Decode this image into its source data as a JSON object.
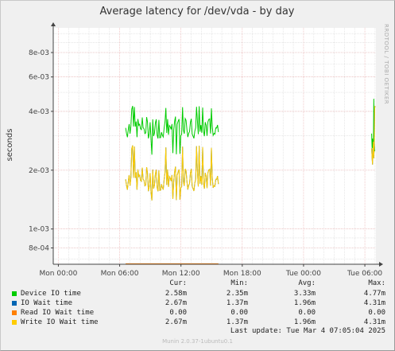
{
  "page": {
    "title": "Average latency for /dev/vda - by day",
    "side_label": "RRDTOOL / TOBI OETIKER",
    "footer": "Munin 2.0.37-1ubuntu0.1",
    "last_update": "Last update: Tue Mar  4 07:05:04 2025"
  },
  "legend": {
    "headers": [
      "Cur:",
      "Min:",
      "Avg:",
      "Max:"
    ],
    "rows": [
      {
        "label": "Device IO time",
        "color": "#00cc00",
        "cur": "2.58m",
        "min": "2.35m",
        "avg": "3.33m",
        "max": "4.77m"
      },
      {
        "label": "IO Wait time",
        "color": "#0066b3",
        "cur": "2.67m",
        "min": "1.37m",
        "avg": "1.96m",
        "max": "4.31m"
      },
      {
        "label": "Read IO Wait time",
        "color": "#ff8000",
        "cur": "0.00",
        "min": "0.00",
        "avg": "0.00",
        "max": "0.00"
      },
      {
        "label": "Write IO Wait time",
        "color": "#ffcc00",
        "cur": "2.67m",
        "min": "1.37m",
        "avg": "1.96m",
        "max": "4.31m"
      }
    ]
  },
  "chart_data": {
    "type": "line",
    "title": "Average latency for /dev/vda - by day",
    "ylabel": "seconds",
    "yscale": "log",
    "ylim": [
      0.00066,
      0.0107
    ],
    "xlim": [
      "Mon 00:00 -30min",
      "Tue 07:05"
    ],
    "x_ticks": [
      "Mon 00:00",
      "Mon 06:00",
      "Mon 12:00",
      "Mon 18:00",
      "Tue 00:00",
      "Tue 06:00"
    ],
    "y_ticks": [
      "8e-04",
      "1e-03",
      "2e-03",
      "4e-03",
      "6e-03",
      "8e-03"
    ],
    "grid": true,
    "series": [
      {
        "name": "Device IO time",
        "color": "#00cc00",
        "segments": [
          {
            "start": "Mon 06:35",
            "end": "Mon 15:40",
            "min": 0.00235,
            "max": 0.0043,
            "center": 0.0033
          },
          {
            "start": "Tue 06:40",
            "end": "Tue 07:00",
            "min": 0.0025,
            "max": 0.00477,
            "center": 0.0027
          }
        ]
      },
      {
        "name": "IO Wait time",
        "color": "#0066b3",
        "segments": [
          {
            "start": "Mon 06:35",
            "end": "Mon 15:40",
            "min": 0.00137,
            "max": 0.0027,
            "center": 0.0018
          },
          {
            "start": "Tue 06:40",
            "end": "Tue 07:00",
            "min": 0.0015,
            "max": 0.00431,
            "center": 0.0026
          }
        ]
      },
      {
        "name": "Read IO Wait time",
        "color": "#ff8000",
        "segments": [
          {
            "start": "Mon 06:35",
            "end": "Mon 15:40",
            "value": 0
          }
        ]
      },
      {
        "name": "Write IO Wait time",
        "color": "#ffcc00",
        "segments": [
          {
            "start": "Mon 06:35",
            "end": "Mon 15:40",
            "min": 0.00137,
            "max": 0.0027,
            "center": 0.0018
          },
          {
            "start": "Tue 06:40",
            "end": "Tue 07:00",
            "min": 0.0015,
            "max": 0.00431,
            "center": 0.0026
          }
        ]
      }
    ]
  }
}
